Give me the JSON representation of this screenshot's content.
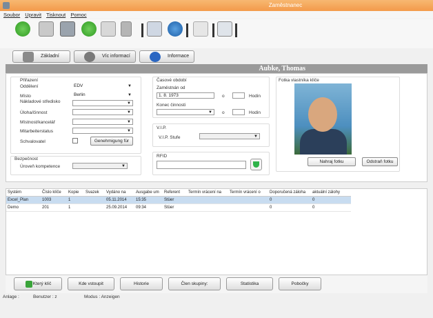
{
  "window": {
    "title": "Zaměstnanec"
  },
  "menu": [
    "Soubor",
    "Upravit",
    "Tisknout",
    "Pomoc"
  ],
  "tabs": [
    "Základní data",
    "Víc informací",
    "Informace"
  ],
  "employee_name": "Aubke, Thomas",
  "assignment": {
    "title": "Přiřazení",
    "department_label": "Oddělení",
    "department_value": "EDV",
    "location_label": "Místo",
    "location_value": "Berlin",
    "cost_center_label": "Nákladové středisko",
    "role_label": "Úloha/činnost",
    "office_label": "Místnost/kancelář",
    "employee_status_label": "Mitarbeiterstatus",
    "approver_label": "Schvalovatel",
    "approval_button": "Genehmigung für"
  },
  "time_period": {
    "title": "Časové období",
    "employed_from_label": "Zaměstnán od",
    "employed_from_value": "1. 8. 1973",
    "o_label": "o",
    "hours_label": "Hodin",
    "end_of_activity_label": "Konec činnosti"
  },
  "vip": {
    "title": "V.I.P.",
    "level_label": "V.I.P. Stufe"
  },
  "security": {
    "title": "Bezpečnost",
    "competence_label": "Úroveň kompetence"
  },
  "rfid": {
    "title": "RFID"
  },
  "photo": {
    "title": "Fotka vlastníka klíče",
    "upload_button": "Nahraj fotku",
    "remove_button": "Odstraň fotku"
  },
  "table": {
    "columns": [
      "Systém",
      "Číslo klíče",
      "Kopie",
      "Svazek",
      "Vydáno na",
      "Ausgabe um",
      "Referent",
      "Termín vrácení na",
      "Termín vrácení o",
      "Doporučená záloha",
      "aktuální zálohy"
    ],
    "rows": [
      [
        "Excel_Plan",
        "1003",
        "1",
        "",
        "05.11.2014",
        "15:35",
        "Stüer",
        "",
        "",
        "0",
        "0"
      ],
      [
        "Demo",
        "201",
        "1",
        "",
        "25.09.2014",
        "09:34",
        "Stüer",
        "",
        "",
        "0",
        "0"
      ]
    ]
  },
  "bottom_tabs": [
    "Který klíč",
    "Kde vstoupit",
    "Historie",
    "Člen skupiny:",
    "Statistika",
    "Pobočky"
  ],
  "status": {
    "anlage": "Anlage :",
    "benutzer": "Benutzer : z",
    "modus": "Modus : Anzeigen"
  },
  "colors": {
    "titlebar": "#f39a4a",
    "selected_row": "#c8dcf0",
    "namebar": "#9a9a9a"
  }
}
